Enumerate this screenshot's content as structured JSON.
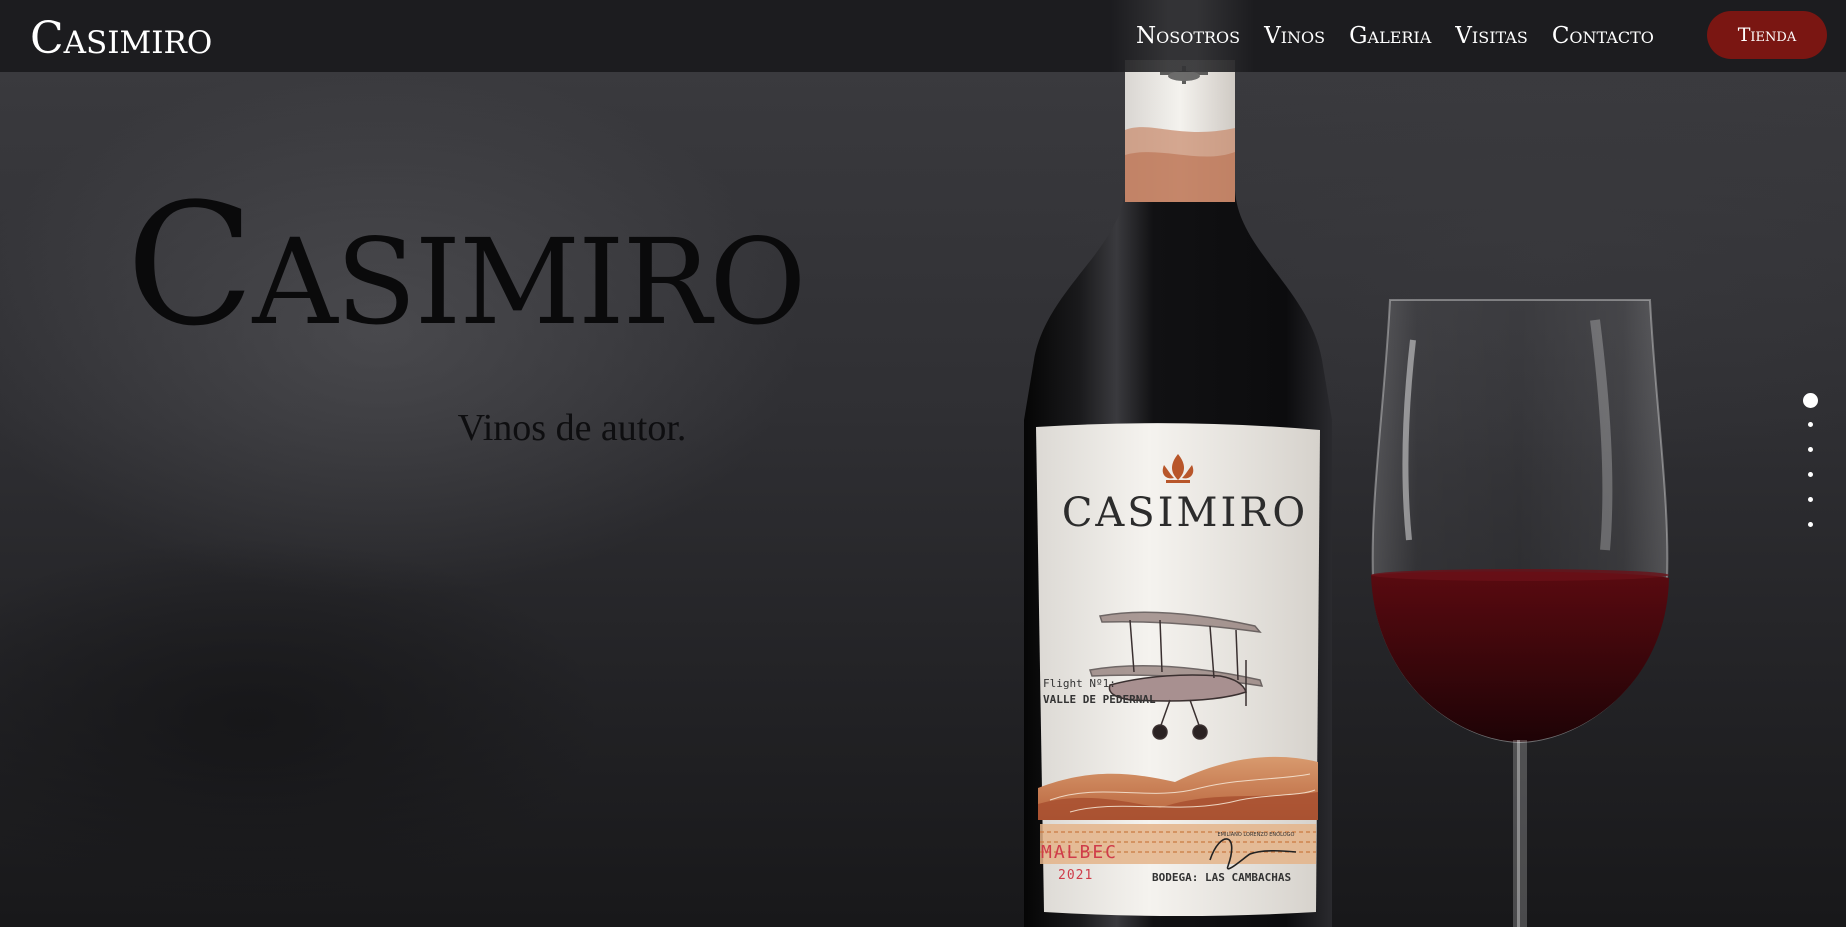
{
  "brand": {
    "logo": "Casimiro"
  },
  "nav": {
    "links": [
      "Nosotros",
      "Vinos",
      "Galeria",
      "Visitas",
      "Contacto"
    ],
    "shop_button": "Tienda"
  },
  "hero": {
    "title": "Casimiro",
    "subtitle": "Vinos de autor."
  },
  "bottle_label": {
    "brand": "CASIMIRO",
    "flight": "Flight Nº1:",
    "region": "VALLE DE PEDERNAL",
    "varietal": "MALBEC",
    "year": "2021",
    "winery": "BODEGA: LAS CAMBACHAS",
    "enologist": "EMILIANO LORENZO ENÓLOGO"
  },
  "slider": {
    "total": 6,
    "active_index": 0
  },
  "colors": {
    "accent": "#7a1612",
    "varietal_text": "#cf3c4a",
    "navbar_bg": "#1a1a1c"
  }
}
